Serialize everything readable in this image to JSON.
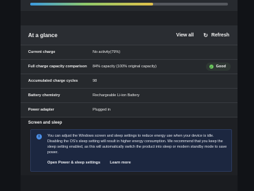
{
  "battery": {
    "fill_percent": 0.62
  },
  "section": {
    "title": "At a glance",
    "view_all": "View all",
    "refresh": "Refresh"
  },
  "rows": [
    {
      "label": "Current charge",
      "value": "No activity(79%)"
    },
    {
      "label": "Full charge capacity comparison",
      "value": "84% capacity (100% original capacity)",
      "badge": "Good",
      "badge_color": "#6ccb5f"
    },
    {
      "label": "Accumulated charge cycles",
      "value": "98"
    },
    {
      "label": "Battery chemistry",
      "value": "Rechargeable Li-ion Battery"
    },
    {
      "label": "Power adapter",
      "value": "Plugged in"
    }
  ],
  "sleep": {
    "title": "Screen and sleep",
    "info": "You can adjust the Windows screen and sleep settings to reduce energy use when your device is idle. Disabling the OS's sleep setting will result in higher energy consumption. We recommend that you keep the sleep setting enabled, as this will automatically switch the product into sleep or modern standby mode to save power.",
    "link_power": "Open Power & sleep settings",
    "link_learn": "Learn more"
  },
  "colors": {
    "info_bg": "#1c2740",
    "info_icon": "#4b8ee6"
  }
}
